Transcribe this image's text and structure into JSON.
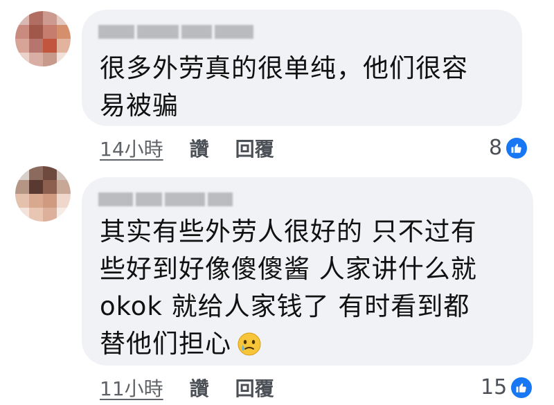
{
  "comments": [
    {
      "text_lines": [
        "很多外劳真的很单纯，他们很容",
        "易被骗"
      ],
      "time": "14小時",
      "like_label": "讚",
      "reply_label": "回覆",
      "reaction_count": "8"
    },
    {
      "text_lines": [
        "其实有些外劳人很好的 只不过有",
        "些好到好像傻傻酱 人家讲什么就",
        "okok 就给人家钱了 有时看到都",
        "替他们担心"
      ],
      "time": "11小時",
      "like_label": "讚",
      "reply_label": "回覆",
      "reaction_count": "15"
    }
  ],
  "colors": {
    "bubble": "#f0f2f5",
    "like_blue": "#1877f2",
    "meta_text": "#5f6266"
  },
  "icons": {
    "like": "thumbs-up-icon",
    "emoji": "face-holding-back-tears-icon"
  }
}
